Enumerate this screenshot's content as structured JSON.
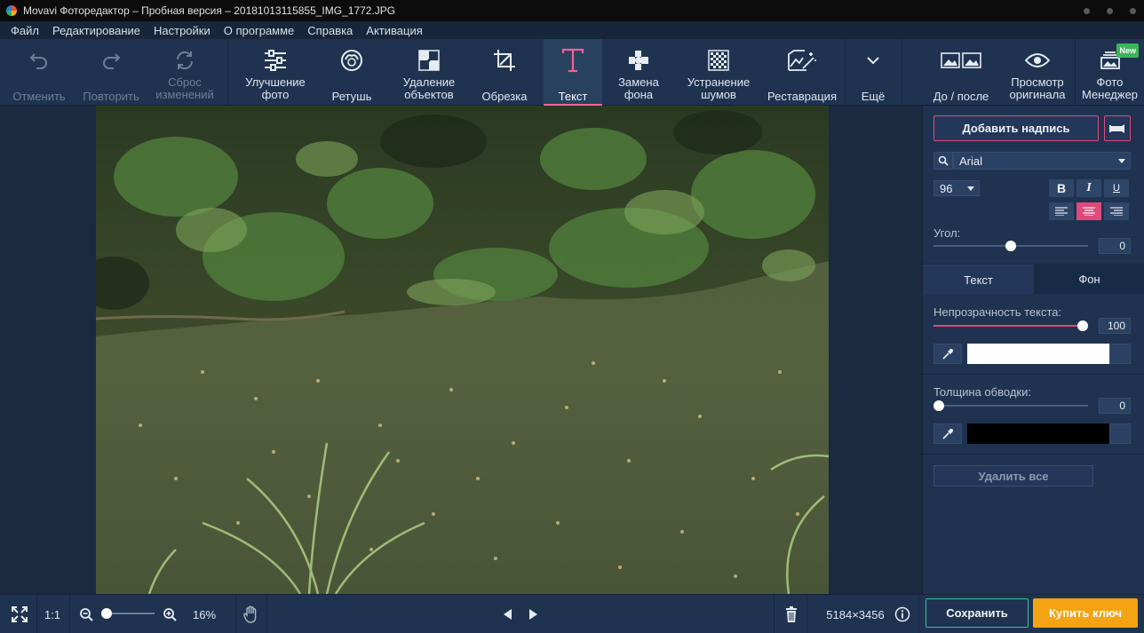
{
  "window": {
    "title": "Movavi Фоторедактор – Пробная версия – 20181013115855_IMG_1772.JPG"
  },
  "menu": [
    "Файл",
    "Редактирование",
    "Настройки",
    "О программе",
    "Справка",
    "Активация"
  ],
  "toolbar": {
    "undo": "Отменить",
    "redo": "Повторить",
    "reset_1": "Сброс",
    "reset_2": "изменений",
    "enhance_1": "Улучшение",
    "enhance_2": "фото",
    "retouch": "Ретушь",
    "remove_1": "Удаление",
    "remove_2": "объектов",
    "crop": "Обрезка",
    "text": "Текст",
    "bg_1": "Замена",
    "bg_2": "фона",
    "denoise_1": "Устранение",
    "denoise_2": "шумов",
    "restore": "Реставрация",
    "more": "Ещё",
    "before_after": "До / после",
    "original_1": "Просмотр",
    "original_2": "оригинала",
    "manager_1": "Фото",
    "manager_2": "Менеджер",
    "new_badge": "New",
    "active_tool": "Текст"
  },
  "panel": {
    "add_caption": "Добавить надпись",
    "font": "Arial",
    "font_size": "96",
    "bold": "B",
    "italic": "I",
    "underline": "U",
    "alignment": "center",
    "angle_label": "Угол:",
    "angle_value": "0",
    "angle_level": 0.5,
    "tab_text": "Текст",
    "tab_bg": "Фон",
    "opacity_label": "Непрозрачность текста:",
    "opacity_value": "100",
    "opacity_level": 1.0,
    "text_color": "#ffffff",
    "stroke_label": "Толщина обводки:",
    "stroke_value": "0",
    "stroke_level": 0,
    "stroke_color": "#000000",
    "delete_all": "Удалить все"
  },
  "bottom": {
    "ratio": "1:1",
    "zoom": "16%",
    "zoom_level": 0.0,
    "dimensions": "5184×3456",
    "save": "Сохранить",
    "buy": "Купить ключ"
  },
  "colors": {
    "accent": "#e0497a",
    "save_border": "#3cbf98",
    "buy": "#f4a313",
    "toolbar_bg": "#1f3350"
  }
}
